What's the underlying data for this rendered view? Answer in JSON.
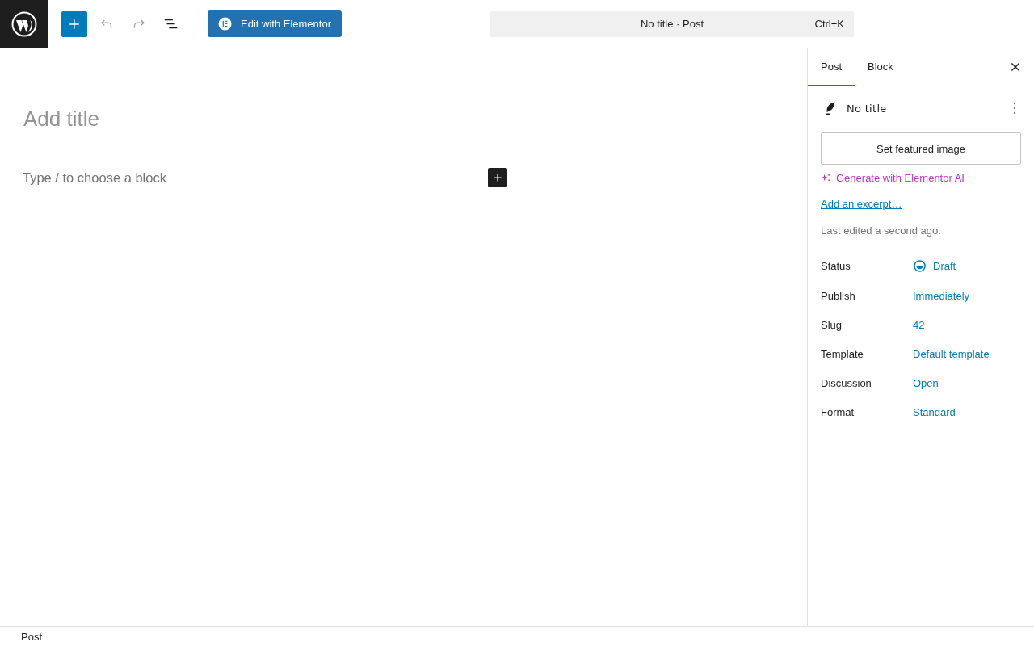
{
  "toolbar": {
    "tools": [
      {
        "kind": "add",
        "disabled": false
      },
      {
        "kind": "undo",
        "disabled": true
      },
      {
        "kind": "redo",
        "disabled": true
      },
      {
        "kind": "outline",
        "disabled": false
      }
    ],
    "elementor_button": "Edit with Elementor",
    "command": {
      "title": "No title · Post",
      "shortcut": "Ctrl+K"
    }
  },
  "editor": {
    "title_placeholder": "Add title",
    "block_placeholder": "Type / to choose a block"
  },
  "sidebar": {
    "tabs": [
      {
        "label": "Post",
        "selected": true
      },
      {
        "label": "Block",
        "selected": false
      }
    ],
    "post_title": "No title",
    "featured_button": "Set featured image",
    "ai_link": "Generate with Elementor AI",
    "excerpt_link": "Add an excerpt…",
    "last_edited": "Last edited a second ago.",
    "fields": [
      {
        "label": "Status",
        "value": "Draft",
        "kind": "status"
      },
      {
        "label": "Publish",
        "value": "Immediately",
        "kind": "plain"
      },
      {
        "label": "Slug",
        "value": "42",
        "kind": "plain"
      },
      {
        "label": "Template",
        "value": "Default template",
        "kind": "plain"
      },
      {
        "label": "Discussion",
        "value": "Open",
        "kind": "plain"
      },
      {
        "label": "Format",
        "value": "Standard",
        "kind": "plain"
      }
    ]
  },
  "footer": {
    "breadcrumb": "Post"
  }
}
